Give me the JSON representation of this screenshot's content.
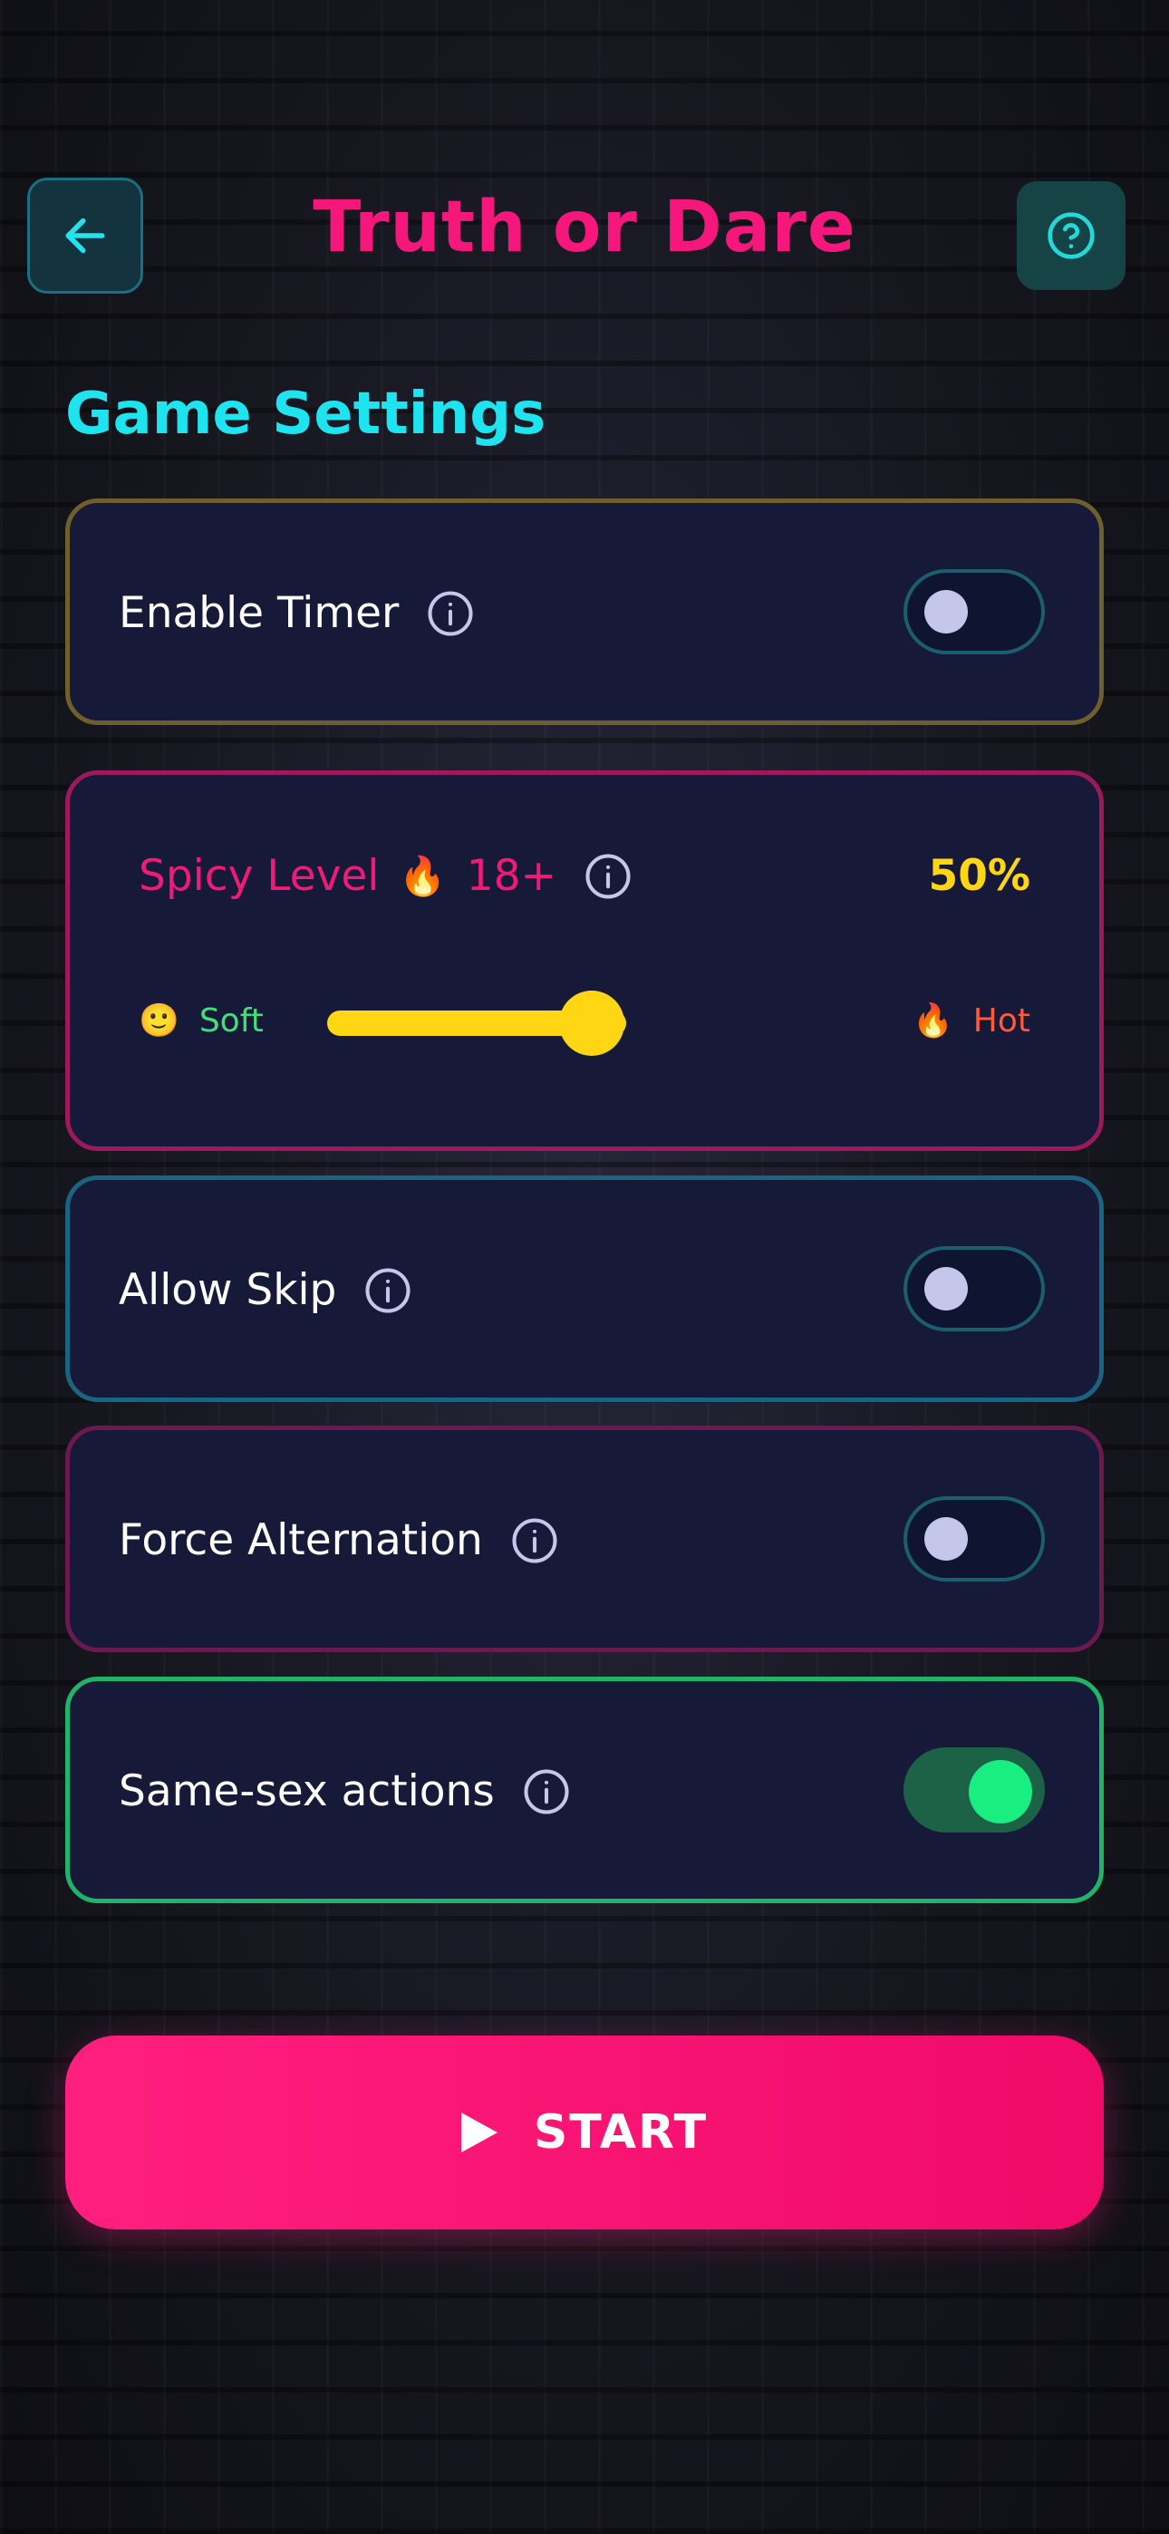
{
  "header": {
    "title": "Truth or Dare",
    "back_icon": "arrow-left-icon",
    "help_icon": "question-circle-icon"
  },
  "section_title": "Game Settings",
  "settings": {
    "timer": {
      "label": "Enable Timer",
      "enabled": false
    },
    "spicy": {
      "label": "Spicy Level",
      "emoji": "🔥",
      "badge": "18+",
      "value_text": "50%",
      "value": 0.5,
      "soft_emoji": "🙂",
      "soft_label": "Soft",
      "hot_emoji": "🔥",
      "hot_label": "Hot"
    },
    "skip": {
      "label": "Allow Skip",
      "enabled": false
    },
    "alternation": {
      "label": "Force Alternation",
      "enabled": false
    },
    "same_sex": {
      "label": "Same-sex actions",
      "enabled": true
    }
  },
  "start_button": {
    "label": "START",
    "icon": "play-icon"
  },
  "colors": {
    "accent_pink": "#f5177b",
    "accent_cyan": "#1ee4ef",
    "accent_yellow": "#ffd613",
    "accent_green": "#18ef80",
    "card_bg": "#161a38"
  }
}
